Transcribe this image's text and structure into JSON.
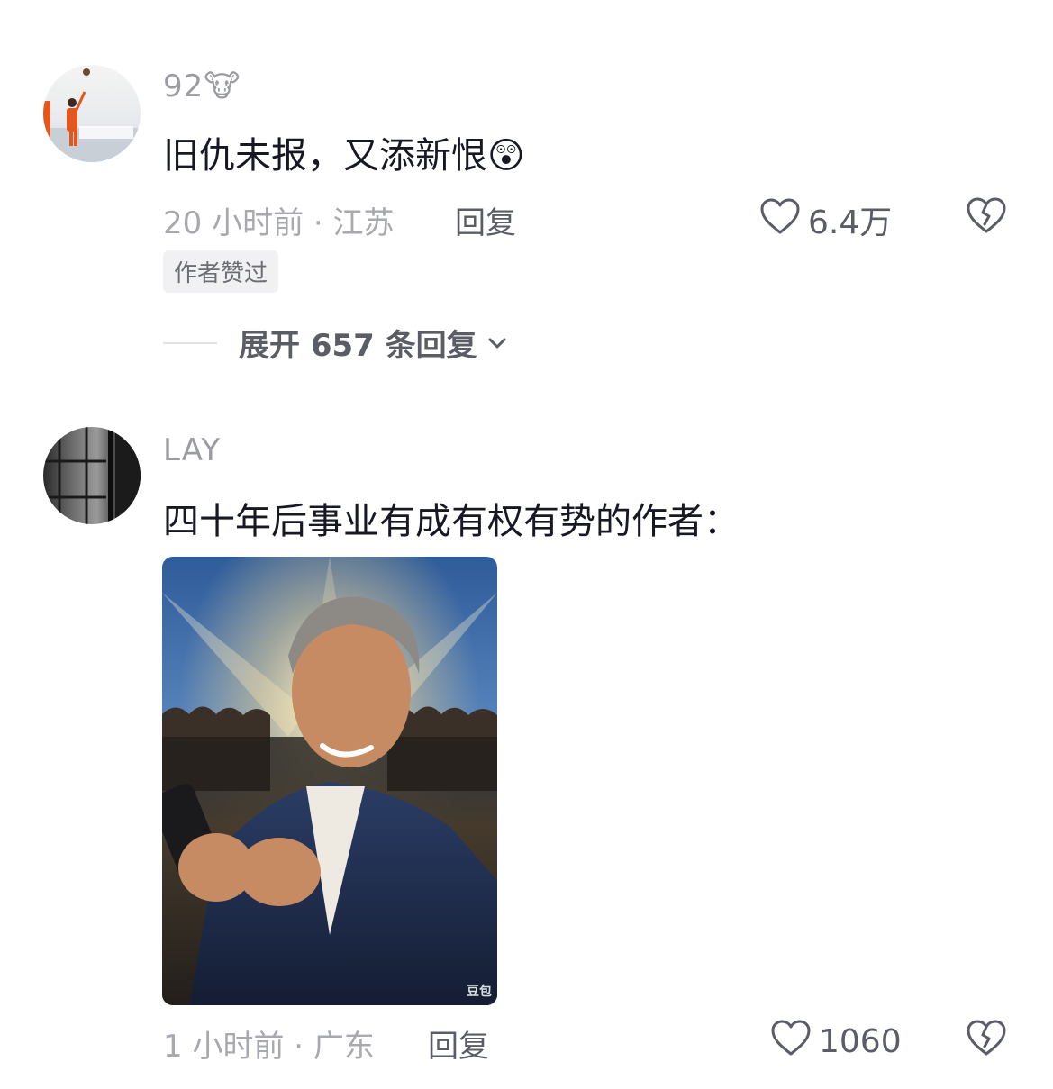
{
  "comments": [
    {
      "username": "92🐮",
      "text": "旧仇未报，又添新恨😲",
      "meta": "20 小时前 · 江苏",
      "reply_label": "回复",
      "likes": "6.4万",
      "badge": "作者赞过",
      "expand_label": "展开 657 条回复"
    },
    {
      "username": "LAY",
      "text": "四十年后事业有成有权有势的作者：",
      "meta": "1 小时前 · 广东",
      "reply_label": "回复",
      "likes": "1060",
      "image_watermark": "豆包"
    }
  ],
  "icons": {
    "like": "heart-outline-icon",
    "dislike": "broken-heart-icon",
    "expand": "chevron-down-icon"
  },
  "colors": {
    "text_primary": "#161823",
    "text_secondary": "#a7a9ae",
    "action": "#5a5d66"
  }
}
